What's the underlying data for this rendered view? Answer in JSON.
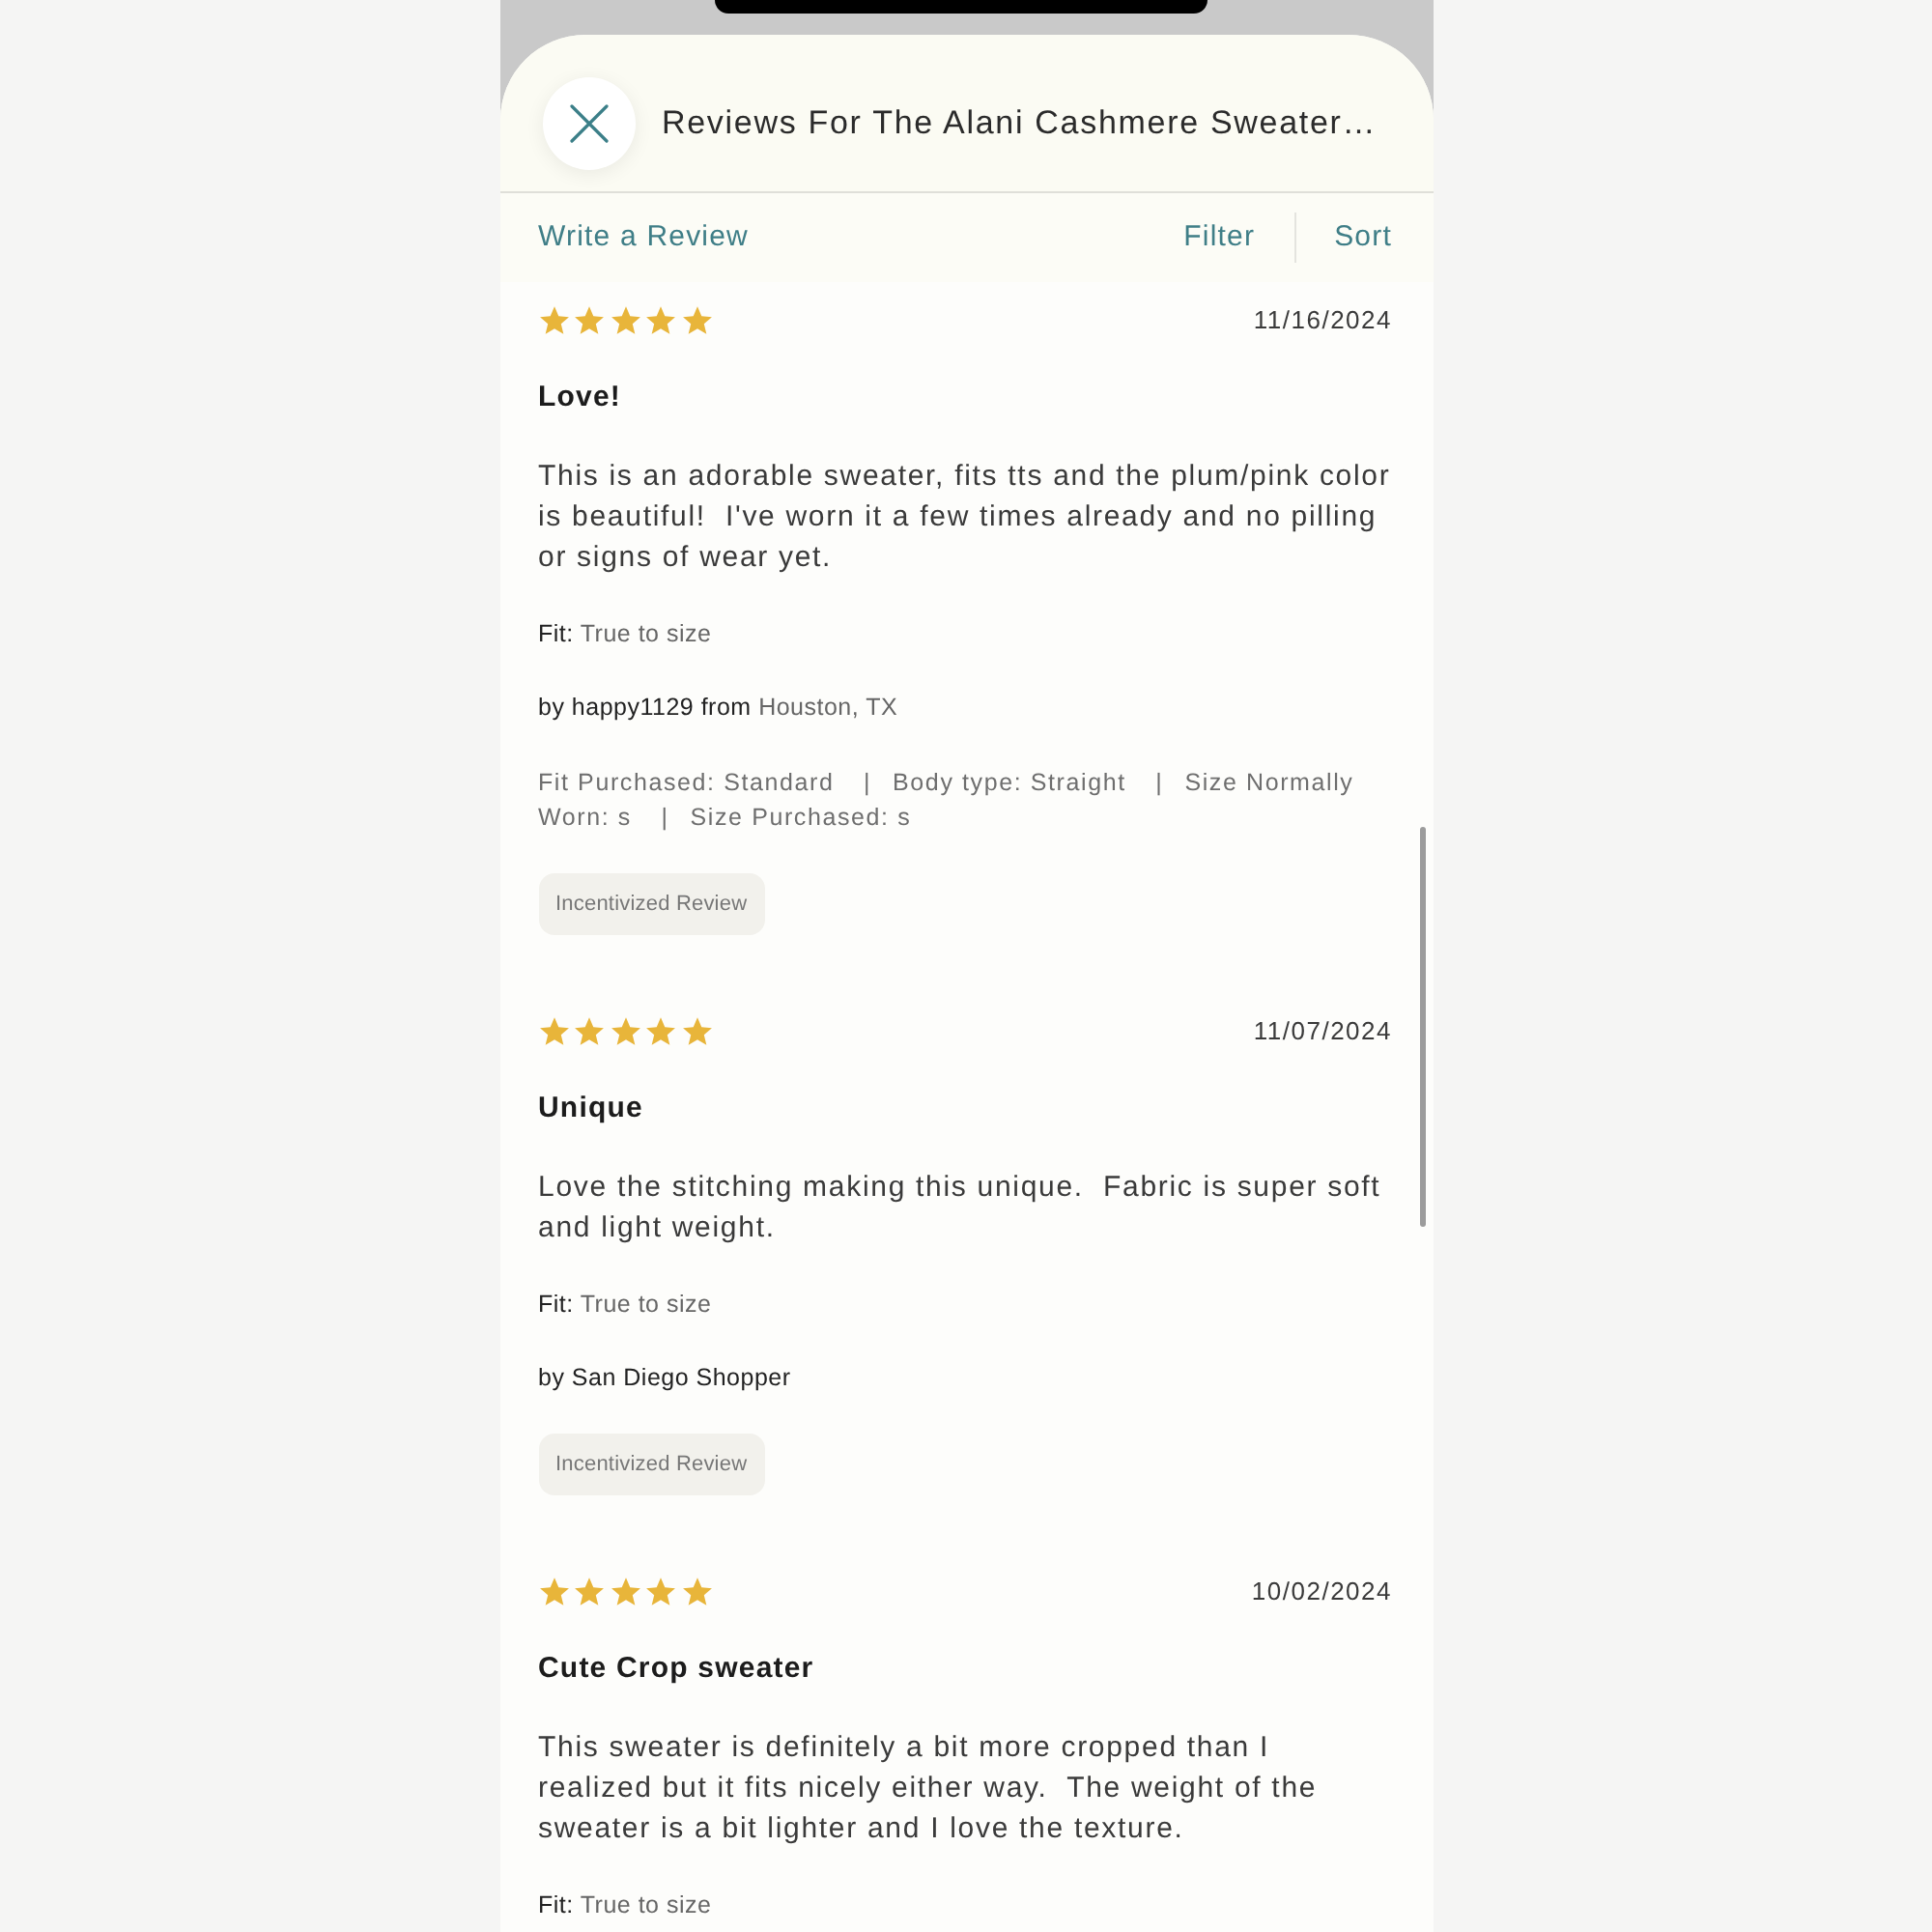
{
  "header": {
    "title": "Reviews For The Alani Cashmere Sweater…"
  },
  "toolbar": {
    "write_review": "Write a Review",
    "filter": "Filter",
    "sort": "Sort"
  },
  "reviews": [
    {
      "stars": 5,
      "date": "11/16/2024",
      "title": "Love!",
      "body": "This is an adorable sweater, fits tts and the plum/pink color is beautiful!  I've worn it a few times already and no pilling or signs of wear yet.",
      "fit_label": "Fit:",
      "fit_value": "True to size",
      "byline": "by happy1129 from",
      "location": "Houston, TX",
      "details": [
        "Fit Purchased: Standard",
        "Body type: Straight",
        "Size Normally Worn: s",
        "Size Purchased: s"
      ],
      "details_separator": "|",
      "badge": "Incentivized Review"
    },
    {
      "stars": 5,
      "date": "11/07/2024",
      "title": "Unique",
      "body": "Love the stitching making this unique.  Fabric is super soft and light weight.",
      "fit_label": "Fit:",
      "fit_value": "True to size",
      "byline": "by San Diego Shopper",
      "badge": "Incentivized Review"
    },
    {
      "stars": 5,
      "date": "10/02/2024",
      "title": "Cute Crop sweater",
      "body": "This sweater is definitely a bit more cropped than I realized but it fits nicely either way.  The weight of the sweater is a bit lighter and I love the texture.",
      "fit_label": "Fit:",
      "fit_value": "True to size"
    }
  ]
}
